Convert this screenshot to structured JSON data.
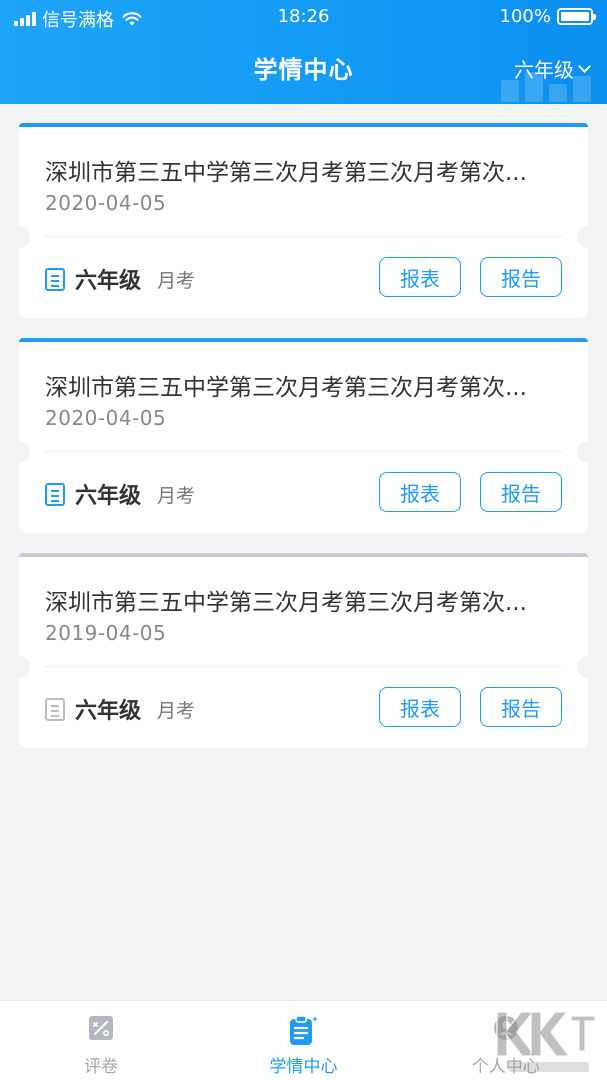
{
  "status_bar": {
    "carrier": "信号满格",
    "time": "18:26",
    "battery": "100%"
  },
  "nav": {
    "title": "学情中心",
    "grade_selector": "六年级"
  },
  "reports": [
    {
      "title": "深圳市第三五中学第三次月考第三次月考第次...",
      "date": "2020-04-05",
      "grade": "六年级",
      "exam_type": "月考",
      "table_button": "报表",
      "report_button": "报告",
      "accent": "#1f9cf2",
      "icon": "document-icon"
    },
    {
      "title": "深圳市第三五中学第三次月考第三次月考第次...",
      "date": "2020-04-05",
      "grade": "六年级",
      "exam_type": "月考",
      "table_button": "报表",
      "report_button": "报告",
      "accent": "#1f9cf2",
      "icon": "document-icon"
    },
    {
      "title": "深圳市第三五中学第三次月考第三次月考第次...",
      "date": "2019-04-05",
      "grade": "六年级",
      "exam_type": "月考",
      "table_button": "报表",
      "report_button": "报告",
      "accent": "#c8cbd0",
      "icon": "document-icon-gray"
    }
  ],
  "tabbar": {
    "tabs": [
      {
        "label": "评卷",
        "icon": "grading-icon",
        "active": false
      },
      {
        "label": "学情中心",
        "icon": "clipboard-icon",
        "active": true
      },
      {
        "label": "个人中心",
        "icon": "person-icon",
        "active": false
      }
    ]
  },
  "colors": {
    "primary": "#1f9cf2",
    "header_start": "#1ea5f8",
    "header_end": "#0b8ff0",
    "background": "#f2f3f5"
  }
}
